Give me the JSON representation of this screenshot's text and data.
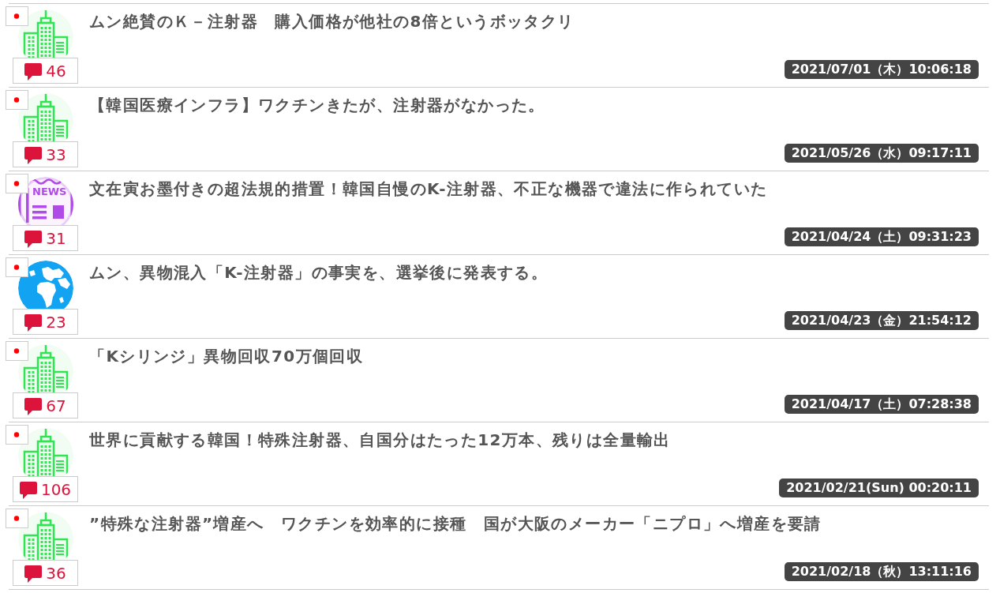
{
  "articles": [
    {
      "thumbnail": {
        "kind": "building"
      },
      "comments": "46",
      "title": "ムン絶賛のＫ－注射器　購入価格が他社の8倍というボッタクリ",
      "date": "2021/07/01（木）10:06:18"
    },
    {
      "thumbnail": {
        "kind": "building"
      },
      "comments": "33",
      "title": "【韓国医療インフラ】ワクチンきたが、注射器がなかった。",
      "date": "2021/05/26（水）09:17:11"
    },
    {
      "thumbnail": {
        "kind": "news",
        "label": "NEWS"
      },
      "comments": "31",
      "title": "文在寅お墨付きの超法規的措置！韓国自慢のK-注射器、不正な機器で違法に作られていた",
      "date": "2021/04/24（土）09:31:23"
    },
    {
      "thumbnail": {
        "kind": "globe"
      },
      "comments": "23",
      "title": "ムン、異物混入「K-注射器」の事実を、選挙後に発表する。",
      "date": "2021/04/23（金）21:54:12"
    },
    {
      "thumbnail": {
        "kind": "building"
      },
      "comments": "67",
      "title": "「Kシリンジ」異物回収70万個回収",
      "date": "2021/04/17（土）07:28:38"
    },
    {
      "thumbnail": {
        "kind": "building"
      },
      "comments": "106",
      "title": "世界に貢献する韓国！特殊注射器、自国分はたった12万本、残りは全量輸出",
      "date": "2021/02/21(Sun) 00:20:11"
    },
    {
      "thumbnail": {
        "kind": "building"
      },
      "comments": "36",
      "title": "”特殊な注射器”増産へ　ワクチンを効率的に接種　国が大阪のメーカー「ニプロ」へ増産を要請",
      "date": "2021/02/18（秋）13:11:16"
    }
  ]
}
